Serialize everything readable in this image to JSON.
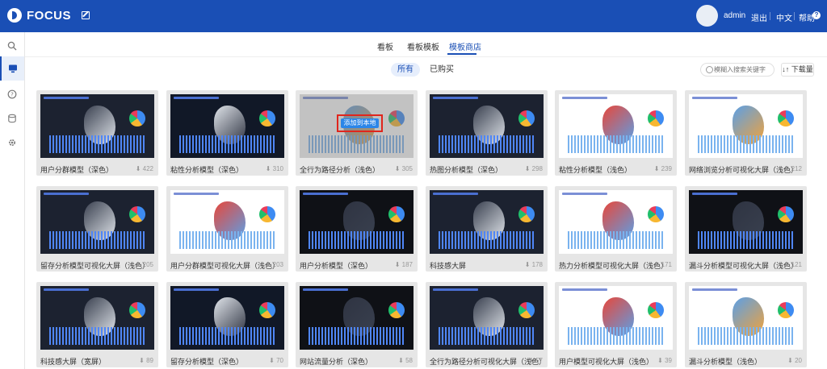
{
  "app": {
    "name": "FOCUS"
  },
  "header": {
    "user": "admin",
    "logout": "退出",
    "language": "中文",
    "help": "帮助"
  },
  "tabs": [
    "看板",
    "看板模板",
    "模板商店"
  ],
  "filters": [
    "所有",
    "已购买"
  ],
  "search": {
    "placeholder": "模糊入搜索关键字"
  },
  "sort": {
    "label": "下载量"
  },
  "hover_action": {
    "label": "添加到本地"
  },
  "icons": {
    "logo": "focus-logo-icon",
    "edit": "edit-icon",
    "help": "help-icon",
    "search": "search-icon",
    "sort": "sort-icon",
    "download": "download-icon"
  },
  "colors": {
    "brand": "#1a4fb5",
    "highlight": "#e0251c",
    "action": "#2b86e8"
  },
  "templates": [
    {
      "name": "用户分群模型（深色）",
      "count": "422",
      "theme": "dark"
    },
    {
      "name": "粘性分析模型（深色）",
      "count": "310",
      "theme": "dark"
    },
    {
      "name": "全行为路径分析（浅色）",
      "count": "305",
      "theme": "light"
    },
    {
      "name": "热图分析模型（深色）",
      "count": "298",
      "theme": "dark"
    },
    {
      "name": "粘性分析模型（浅色）",
      "count": "239",
      "theme": "light"
    },
    {
      "name": "网络浏览分析可视化大屏（浅色）",
      "count": "212",
      "theme": "light"
    },
    {
      "name": "留存分析模型可视化大屏（浅色）",
      "count": "205",
      "theme": "dark"
    },
    {
      "name": "用户分群模型可视化大屏（浅色）",
      "count": "203",
      "theme": "light"
    },
    {
      "name": "用户分析模型（深色）",
      "count": "187",
      "theme": "dark"
    },
    {
      "name": "科技感大屏",
      "count": "178",
      "theme": "dark"
    },
    {
      "name": "热力分析模型可视化大屏（浅色）",
      "count": "171",
      "theme": "light"
    },
    {
      "name": "漏斗分析模型可视化大屏（浅色）",
      "count": "121",
      "theme": "dark"
    },
    {
      "name": "科技感大屏（宽屏）",
      "count": "89",
      "theme": "dark"
    },
    {
      "name": "留存分析模型（深色）",
      "count": "70",
      "theme": "dark"
    },
    {
      "name": "网站流量分析（深色）",
      "count": "58",
      "theme": "dark"
    },
    {
      "name": "全行为路径分析可视化大屏（浅色）",
      "count": "57",
      "theme": "dark"
    },
    {
      "name": "用户模型可视化大屏（浅色）",
      "count": "39",
      "theme": "light"
    },
    {
      "name": "漏斗分析模型（浅色）",
      "count": "20",
      "theme": "light"
    }
  ]
}
